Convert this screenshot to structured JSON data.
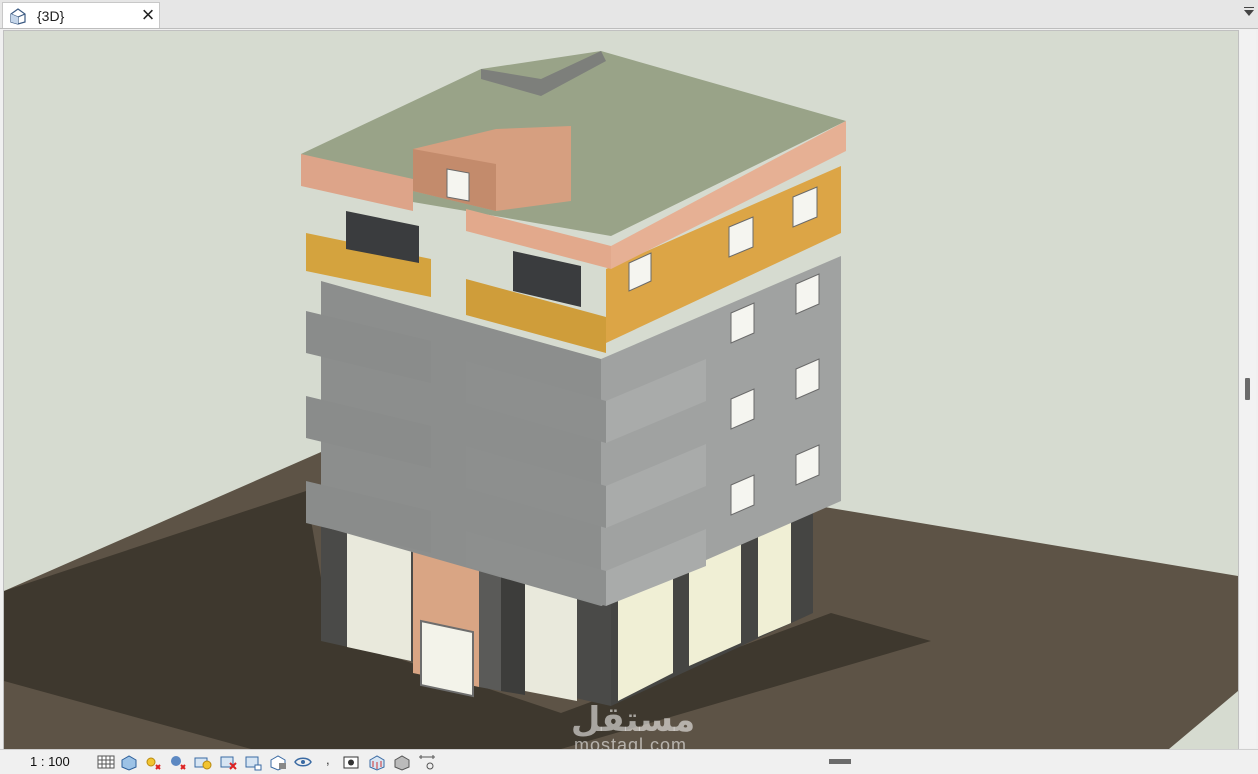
{
  "tab": {
    "title": "{3D}",
    "icon": "3d-view-icon",
    "close_icon": "close-icon"
  },
  "statusbar": {
    "scale": "1 : 100",
    "icons": [
      "detail-level-icon",
      "visual-style-icon",
      "sun-path-icon",
      "shadows-icon",
      "render-icon",
      "crop-view-icon",
      "show-crop-region-icon",
      "lock-3d-view-icon",
      "temporary-hide-isolate-icon",
      "separator-comma",
      "reveal-hidden-elements-icon",
      "worksharing-display-icon",
      "analytical-model-icon",
      "highlight-displacement-icon"
    ]
  },
  "watermark": {
    "arabic": "مستقل",
    "latin": "mostaql.com"
  },
  "colors": {
    "background": "#d6dbd0",
    "ground": "#5d5346",
    "shadow": "#3c352c",
    "concrete": "#9b9d9c",
    "orange": "#d6a544",
    "salmon": "#e3ab8d",
    "roof": "#9aa487",
    "stone": "#3f3f3f",
    "shopfront": "#ececde"
  }
}
